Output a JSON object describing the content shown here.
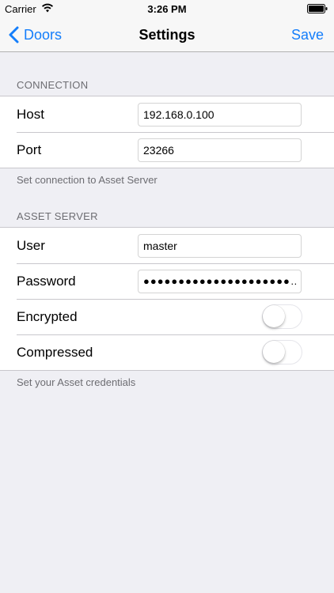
{
  "status_bar": {
    "carrier": "Carrier",
    "time": "3:26 PM",
    "wifi_icon": "wifi-icon",
    "battery_icon": "battery-icon"
  },
  "nav": {
    "back_label": "Doors",
    "title": "Settings",
    "save_label": "Save",
    "accent_color": "#147efb"
  },
  "connection": {
    "header": "CONNECTION",
    "host_label": "Host",
    "host_value": "192.168.0.100",
    "port_label": "Port",
    "port_value": "23266",
    "footer": "Set connection to Asset Server"
  },
  "asset_server": {
    "header": "ASSET SERVER",
    "user_label": "User",
    "user_value": "master",
    "password_label": "Password",
    "password_value": "●●●●●●●●●●●●●●●●●●●●●…",
    "encrypted_label": "Encrypted",
    "encrypted_on": false,
    "compressed_label": "Compressed",
    "compressed_on": false,
    "footer": "Set your Asset credentials"
  }
}
